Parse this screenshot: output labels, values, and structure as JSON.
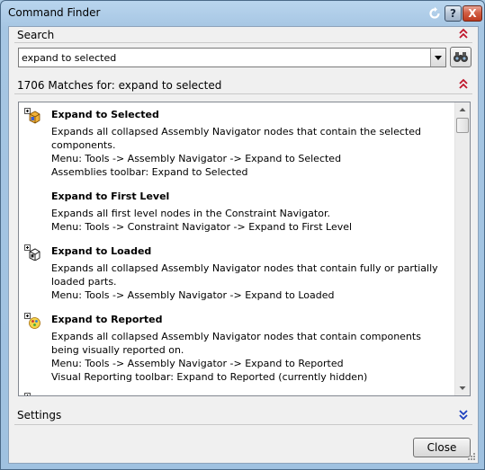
{
  "window": {
    "title": "Command Finder",
    "help_label": "?",
    "close_label": "X"
  },
  "search": {
    "header": "Search",
    "value": "expand to selected"
  },
  "results": {
    "header": "1706 Matches for: expand to selected",
    "items": [
      {
        "title": "Expand to Selected",
        "icon": "assembly-expand-icon",
        "lines": [
          "Expands all collapsed Assembly Navigator nodes that contain the selected",
          "components.",
          "Menu: Tools -> Assembly Navigator -> Expand to Selected",
          "Assemblies toolbar: Expand to Selected"
        ]
      },
      {
        "title": "Expand to First Level",
        "icon": "",
        "lines": [
          "Expands all first level nodes in the Constraint Navigator.",
          "Menu: Tools -> Constraint Navigator -> Expand to First Level"
        ]
      },
      {
        "title": "Expand to Loaded",
        "icon": "loaded-parts-icon",
        "lines": [
          "Expands all collapsed Assembly Navigator nodes that contain fully or partially",
          "loaded parts.",
          "Menu: Tools -> Assembly Navigator -> Expand to Loaded"
        ]
      },
      {
        "title": "Expand to Reported",
        "icon": "visual-reporting-icon",
        "lines": [
          "Expands all collapsed Assembly Navigator nodes that contain components",
          "being visually reported on.",
          "Menu: Tools -> Assembly Navigator -> Expand to Reported",
          "Visual Reporting toolbar: Expand to Reported (currently hidden)"
        ]
      }
    ]
  },
  "settings": {
    "header": "Settings"
  },
  "footer": {
    "close_label": "Close"
  },
  "colors": {
    "chevron": "#c0152a",
    "chevron_down": "#1d3fbf",
    "title_bar": "#a9c9e4"
  }
}
